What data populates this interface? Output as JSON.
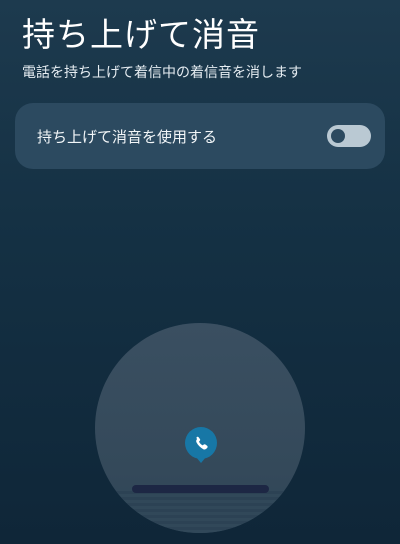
{
  "page": {
    "title": "持ち上げて消音",
    "subtitle": "電話を持ち上げて着信中の着信音を消します"
  },
  "setting": {
    "label": "持ち上げて消音を使用する",
    "enabled": false
  },
  "illustration": {
    "icon": "phone-icon",
    "badge_color": "#1777a6"
  }
}
